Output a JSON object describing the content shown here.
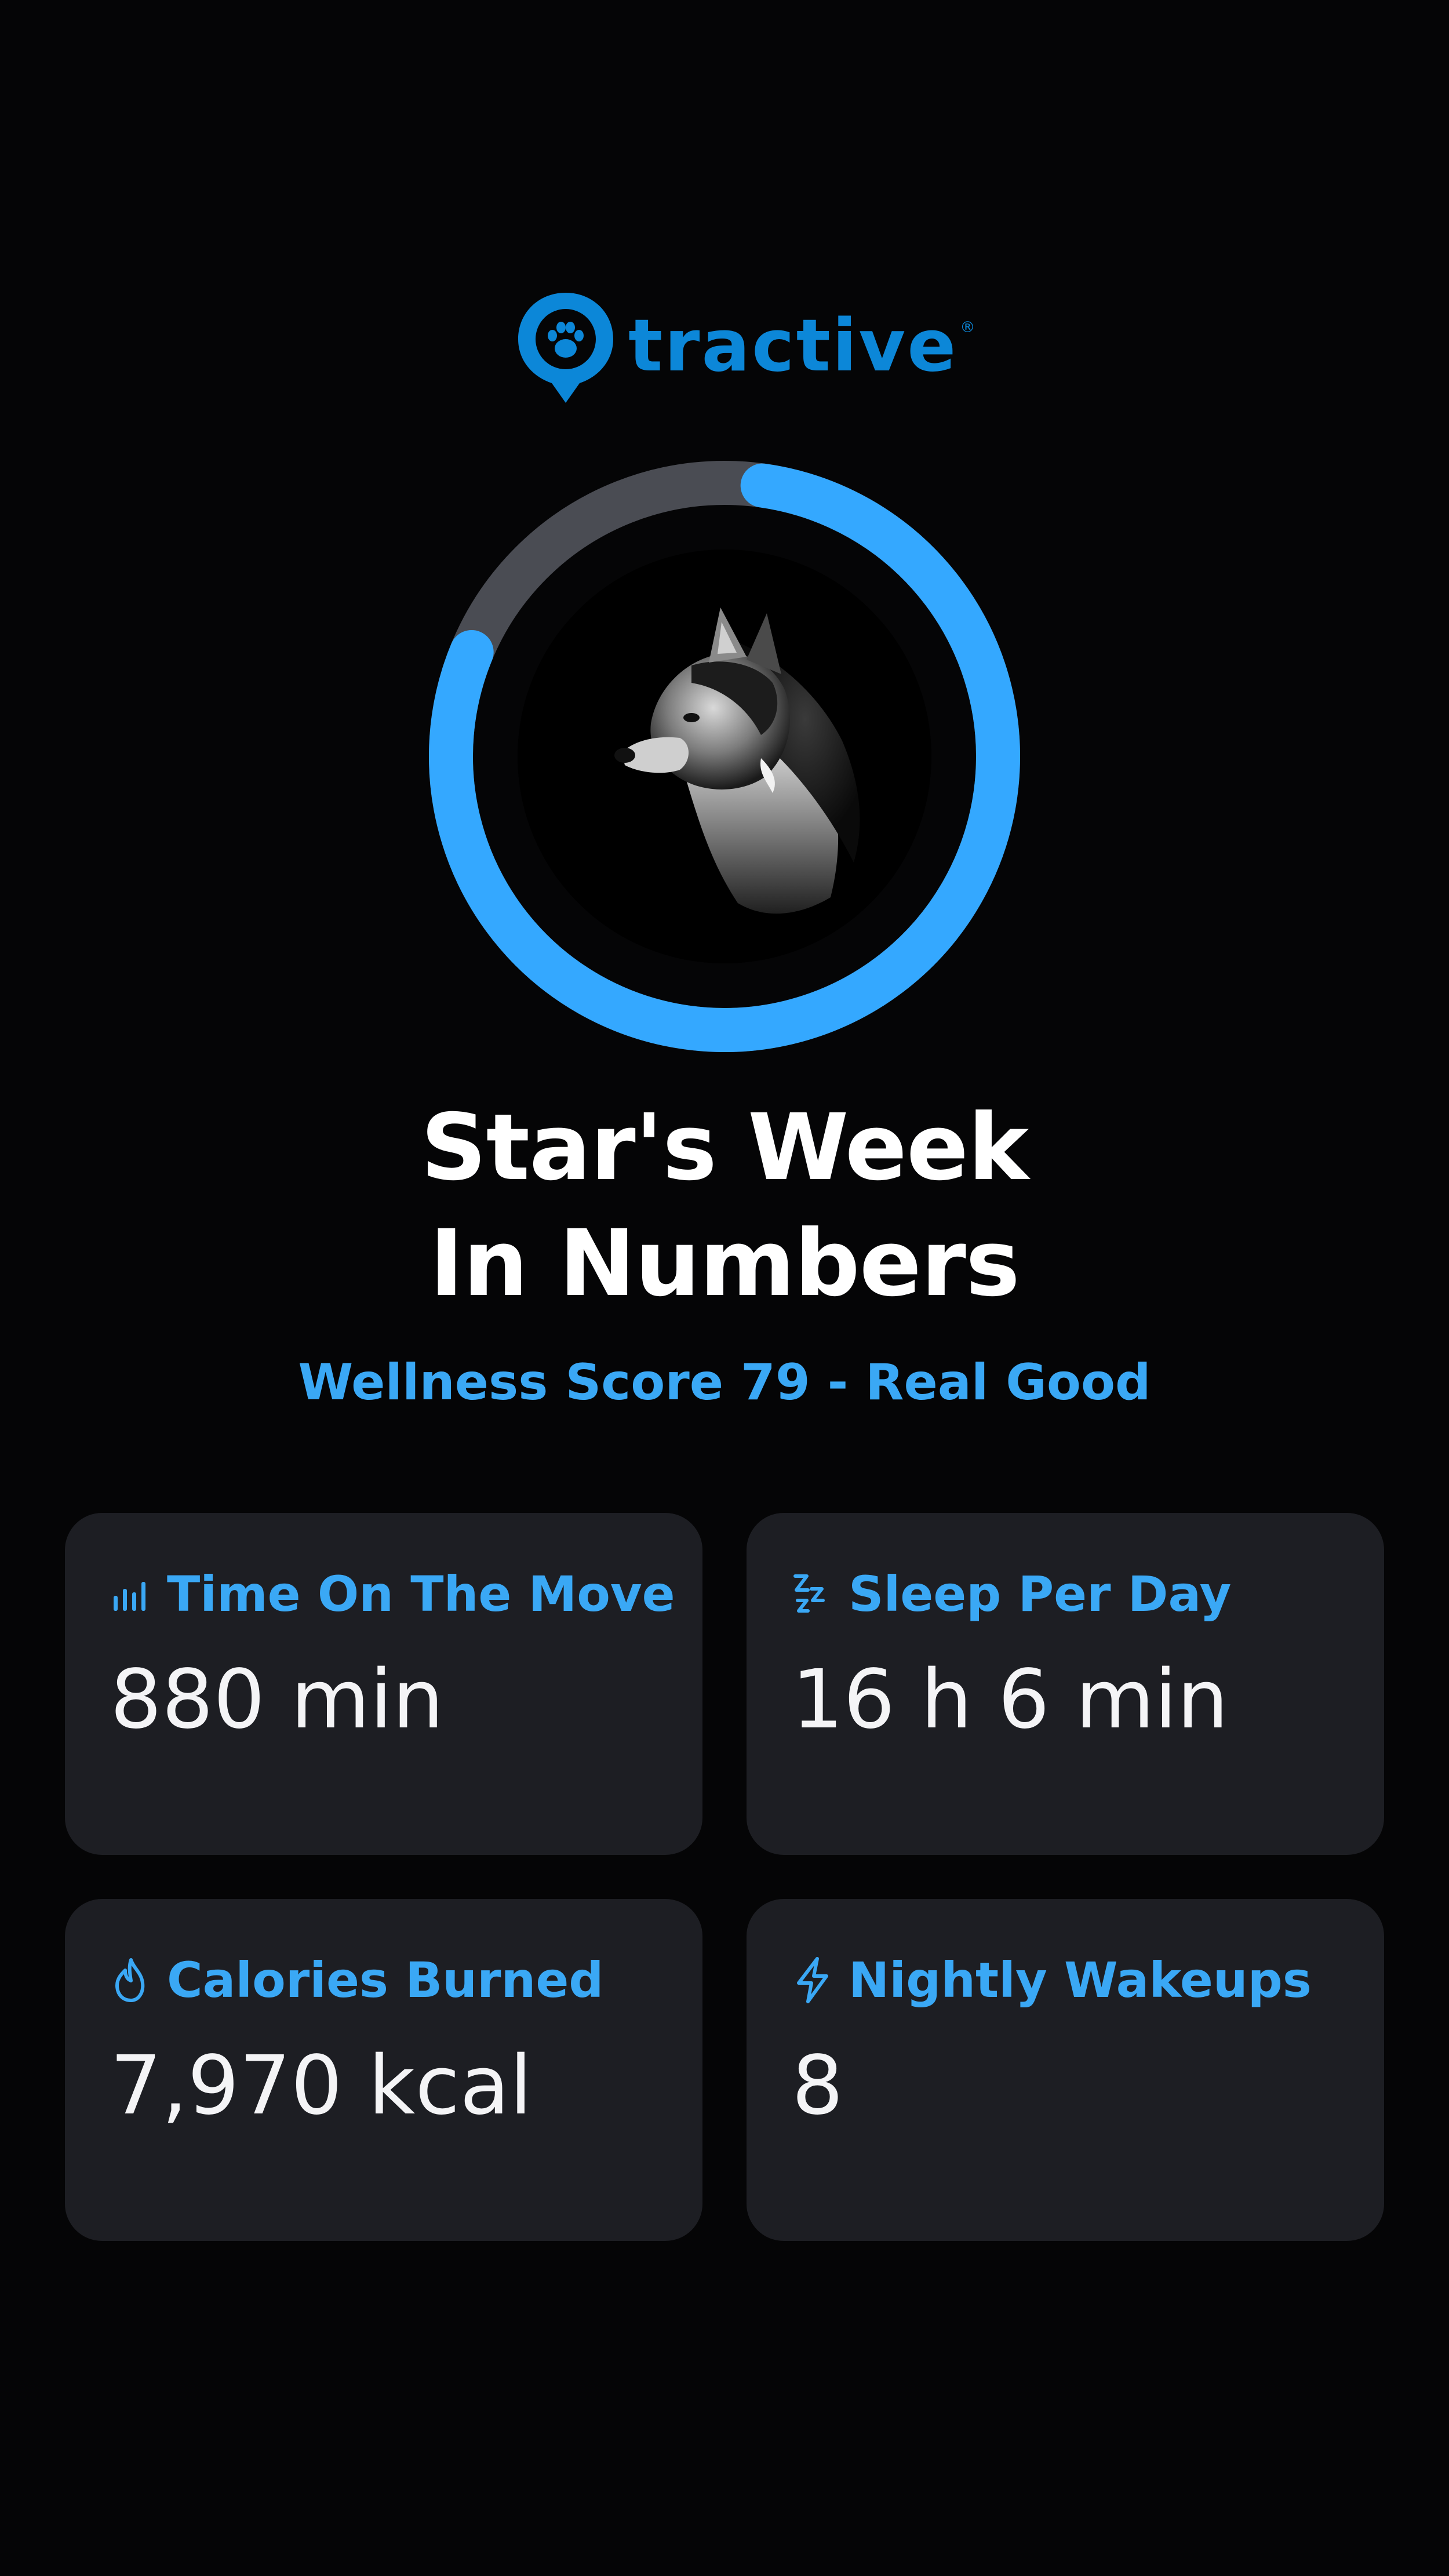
{
  "brand": {
    "name": "tractive",
    "registered_mark": "®",
    "color": "#0c87d8"
  },
  "wellness_ring": {
    "score": 79,
    "progress_color": "#34a8ff",
    "track_color": "#4a4c53",
    "photo": "husky-dog-portrait"
  },
  "header": {
    "title_line1": "Star's Week",
    "title_line2": "In Numbers",
    "subtitle": "Wellness Score 79 - Real Good"
  },
  "stats": [
    {
      "icon": "activity-bars-icon",
      "label": "Time On The Move",
      "value": "880 min"
    },
    {
      "icon": "sleep-zzz-icon",
      "label": "Sleep Per Day",
      "value": "16 h 6 min"
    },
    {
      "icon": "flame-icon",
      "label": "Calories Burned",
      "value": "7,970 kcal"
    },
    {
      "icon": "lightning-bolt-icon",
      "label": "Nightly Wakeups",
      "value": "8"
    }
  ],
  "colors": {
    "background": "#050506",
    "card_background": "#1d1e23",
    "accent": "#3aa8f5",
    "text": "#ffffff"
  }
}
